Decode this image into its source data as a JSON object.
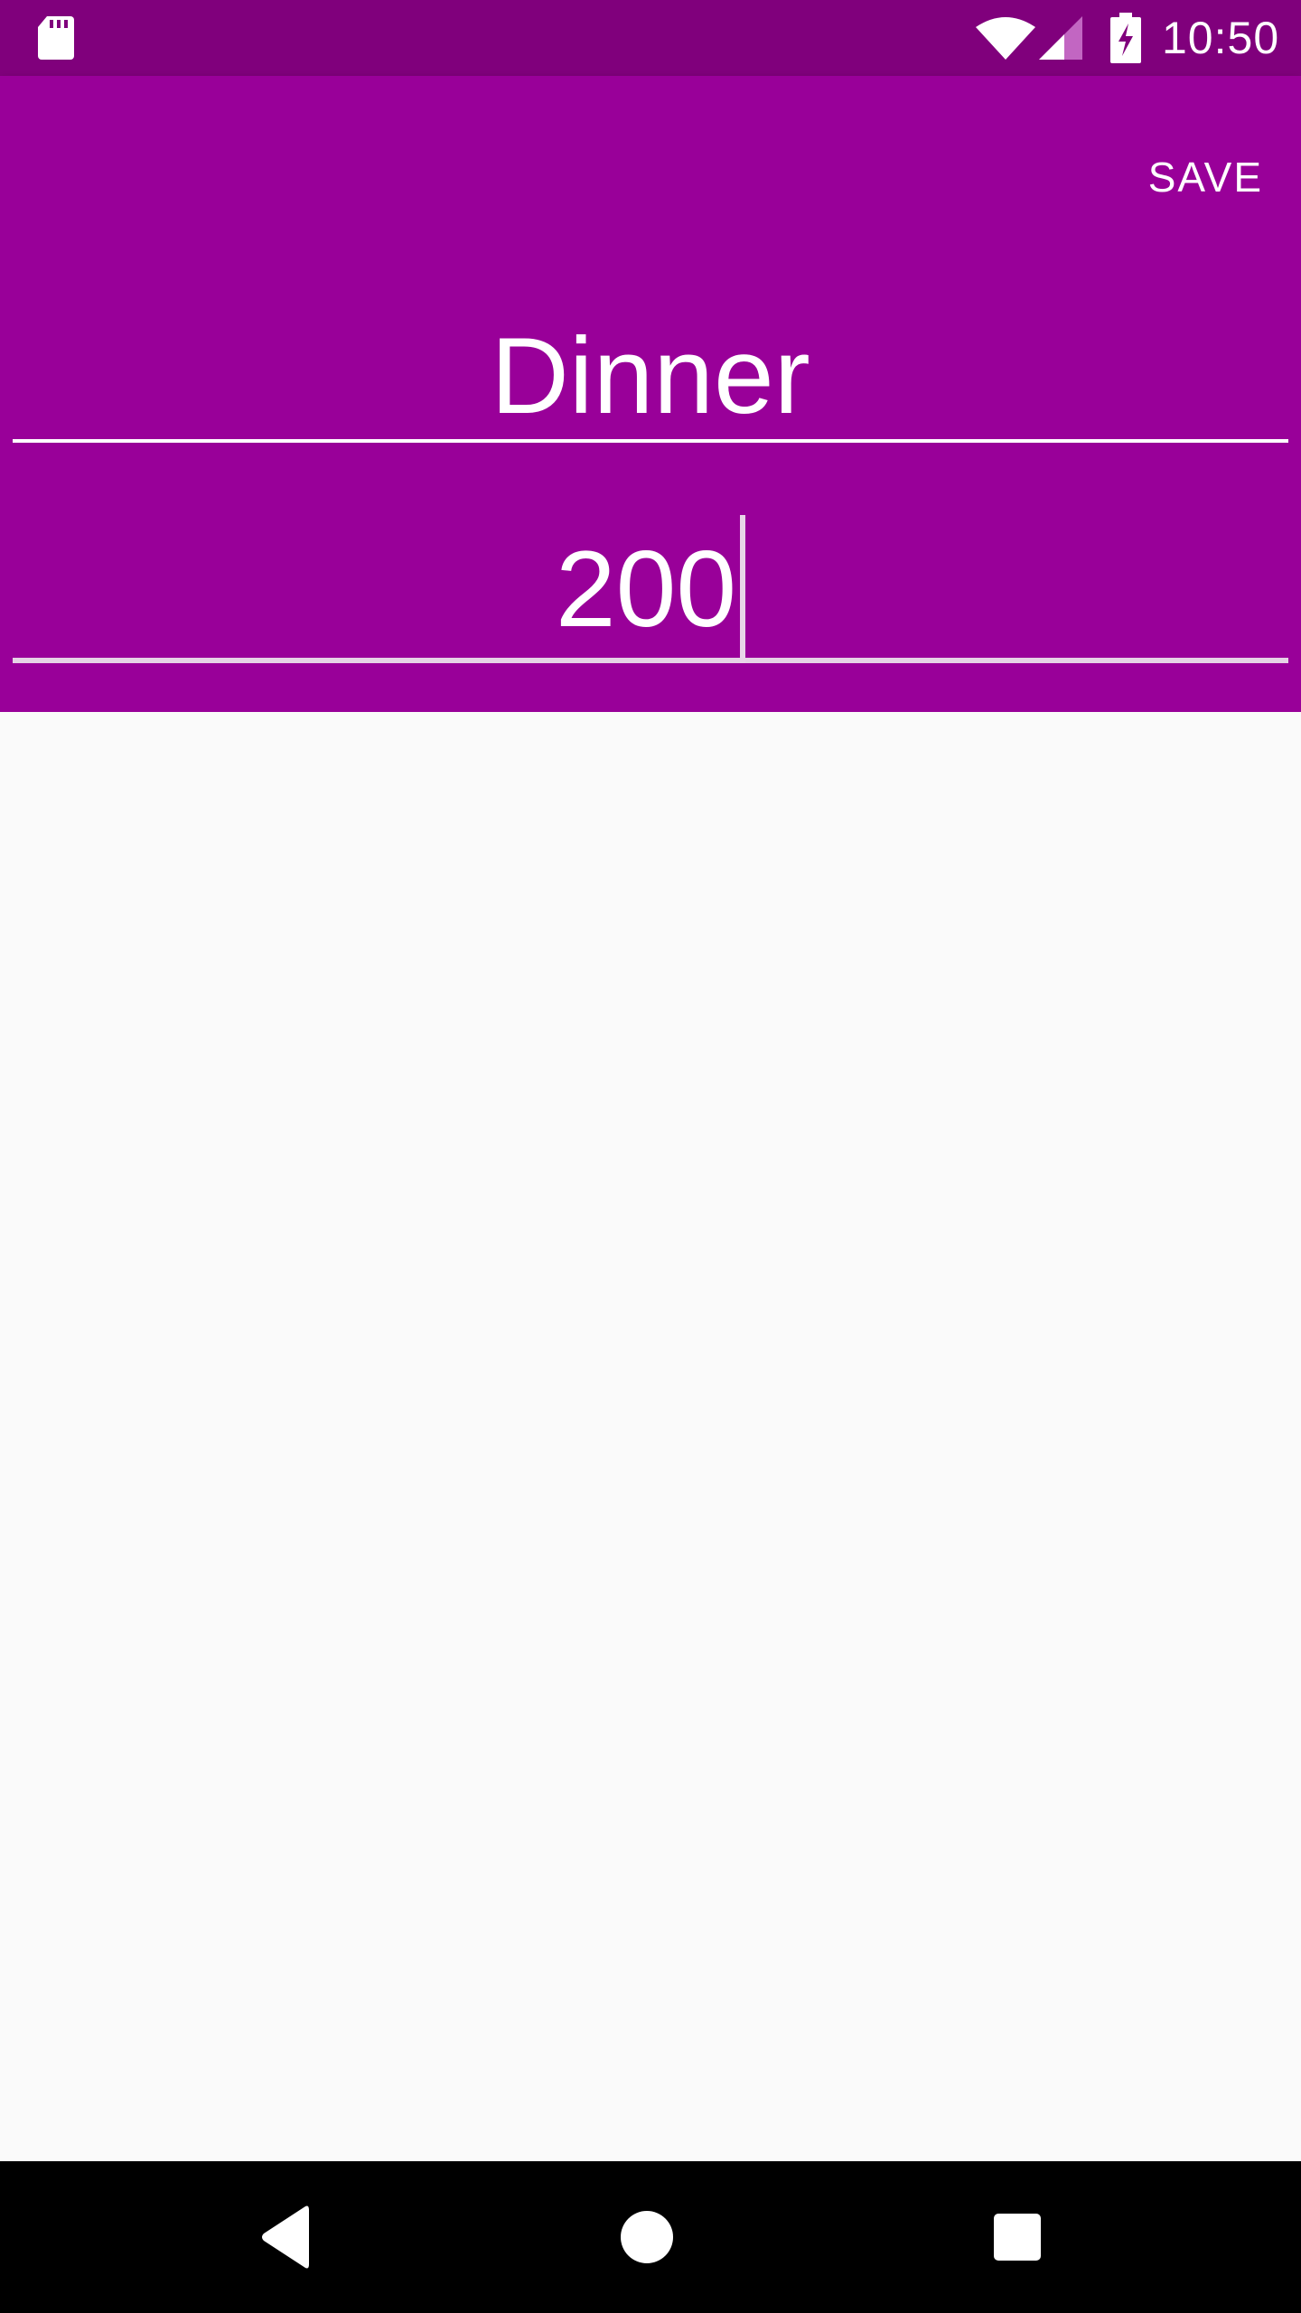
{
  "status_bar": {
    "time": "10:50",
    "icons": [
      "sd-card-icon",
      "wifi-icon",
      "cell-signal-icon",
      "battery-charging-icon"
    ]
  },
  "toolbar": {
    "save_label": "SAVE"
  },
  "form": {
    "title_value": "Dinner",
    "amount_value": "200"
  },
  "nav_bar": {
    "buttons": [
      "back-icon",
      "home-icon",
      "recents-icon"
    ]
  },
  "colors": {
    "status_bar": "#80007c",
    "primary": "#990099",
    "background": "#fafafa",
    "text_on_primary": "#ffffff",
    "nav_bar": "#000000"
  }
}
